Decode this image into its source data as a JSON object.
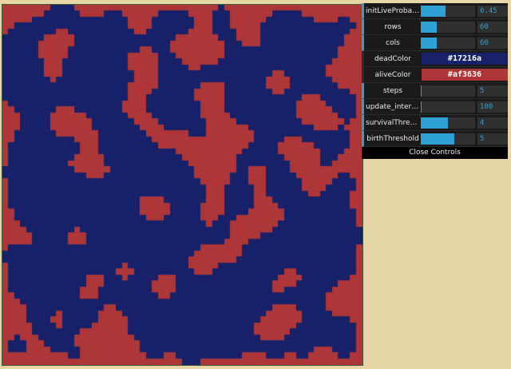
{
  "controls": [
    {
      "key": "initLiveProbability",
      "label": "initLiveProbabil...",
      "value": "0.45",
      "fraction": 0.45
    },
    {
      "key": "rows",
      "label": "rows",
      "value": "60",
      "fraction": 0.3
    },
    {
      "key": "cols",
      "label": "cols",
      "value": "60",
      "fraction": 0.3
    },
    {
      "key": "steps",
      "label": "steps",
      "value": "5",
      "fraction": 0.02
    },
    {
      "key": "update_interval",
      "label": "update_interval",
      "value": "100",
      "fraction": 0.02
    },
    {
      "key": "survivalThreshold",
      "label": "survivalThreshold",
      "value": "4",
      "fraction": 0.5
    },
    {
      "key": "birthThreshold",
      "label": "birthThreshold",
      "value": "5",
      "fraction": 0.62
    }
  ],
  "colors": {
    "deadColor": {
      "label": "deadColor",
      "value": "#17216a"
    },
    "aliveColor": {
      "label": "aliveColor",
      "value": "#af3636"
    }
  },
  "close_label": "Close Controls",
  "grid": {
    "rows": 60,
    "cols": 60,
    "dead": "#17216a",
    "alive": "#af3636"
  }
}
